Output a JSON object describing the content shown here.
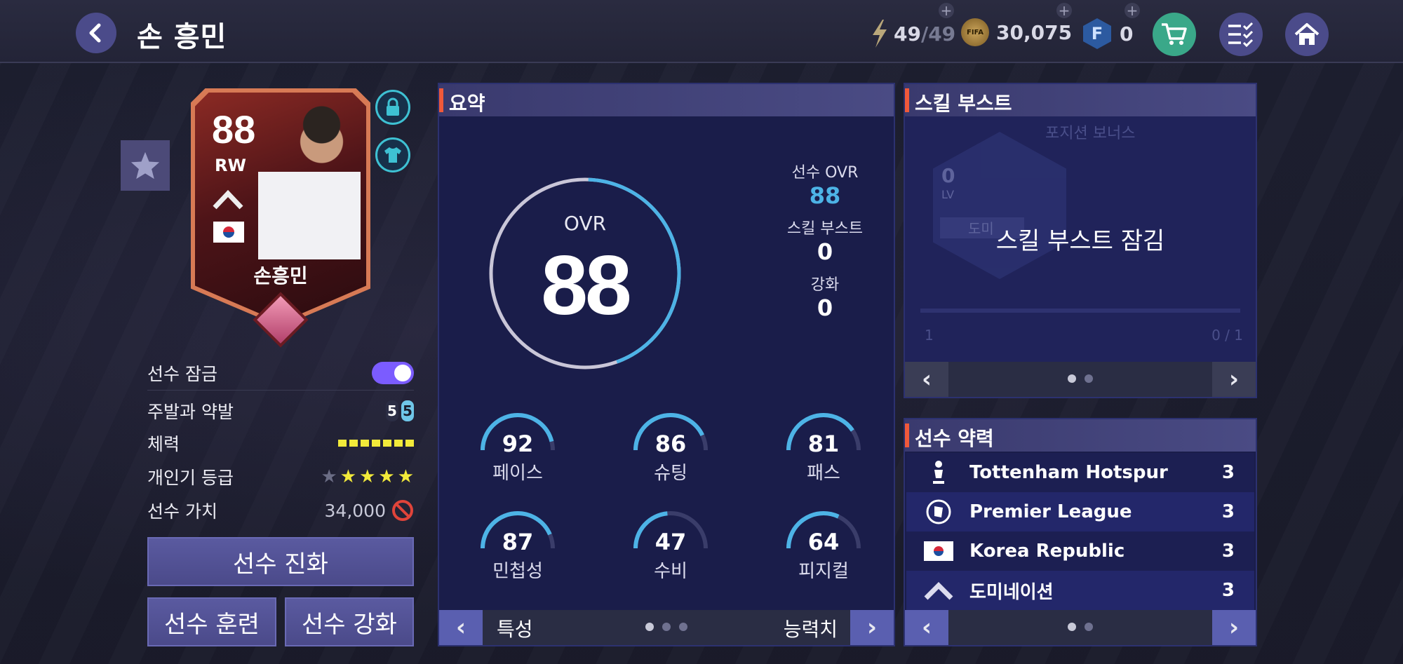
{
  "header": {
    "title": "손 흥민",
    "energy": "49",
    "energy_max": "/49",
    "coins": "30,075",
    "fc_points": "0",
    "coin_label": "FIFA"
  },
  "card": {
    "ovr": "88",
    "position": "RW",
    "name": "손흥민"
  },
  "info": {
    "lock_label": "선수 잠금",
    "foot_label": "주발과 약발",
    "foot_left": "5",
    "foot_right": "5",
    "stamina_label": "체력",
    "rating_label": "개인기 등급",
    "skill_stars": 4,
    "value_label": "선수 가치",
    "value": "34,000"
  },
  "buttons": {
    "evolve": "선수 진화",
    "train": "선수 훈련",
    "enhance": "선수 강화"
  },
  "summary": {
    "title": "요약",
    "ovr_label": "OVR",
    "ovr_value": "88",
    "player_ovr_label": "선수 OVR",
    "player_ovr_value": "88",
    "skill_boost_label": "스킬 부스트",
    "skill_boost_value": "0",
    "enhance_label": "강화",
    "enhance_value": "0",
    "stats": [
      {
        "value": "92",
        "name": "페이스",
        "pct": 0.92
      },
      {
        "value": "86",
        "name": "슈팅",
        "pct": 0.86
      },
      {
        "value": "81",
        "name": "패스",
        "pct": 0.81
      },
      {
        "value": "87",
        "name": "민첩성",
        "pct": 0.87
      },
      {
        "value": "47",
        "name": "수비",
        "pct": 0.47
      },
      {
        "value": "64",
        "name": "피지컬",
        "pct": 0.64
      }
    ],
    "footer_left": "특성",
    "footer_right": "능력치"
  },
  "skill_boost": {
    "title": "스킬 부스트",
    "bg_label": "포지션 보너스",
    "locked_text": "스킬 부스트 잠김",
    "level": "0",
    "level_unit": "LV",
    "badge_text": "도미",
    "count_left": "1",
    "progress": "0 / 1"
  },
  "chemistry": {
    "title": "선수 약력",
    "rows": [
      {
        "name": "Tottenham Hotspur",
        "value": "3"
      },
      {
        "name": "Premier League",
        "value": "3"
      },
      {
        "name": "Korea Republic",
        "value": "3"
      },
      {
        "name": "도미네이션",
        "value": "3"
      }
    ]
  },
  "colors": {
    "accent_teal": "#3ec1d3",
    "panel": "#1a1d4a",
    "button": "#4b4a8a",
    "toggle": "#7b5cff",
    "ovr_value": "#4db3e6"
  }
}
